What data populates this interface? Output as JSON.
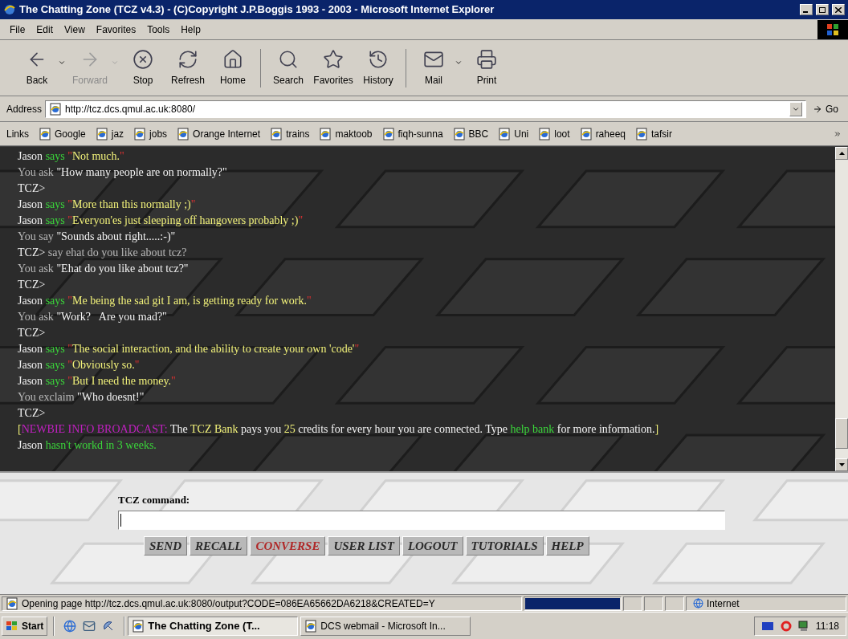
{
  "window": {
    "title": "The Chatting Zone (TCZ v4.3) - (C)Copyright J.P.Boggis 1993 - 2003 - Microsoft Internet Explorer"
  },
  "menu": [
    "File",
    "Edit",
    "View",
    "Favorites",
    "Tools",
    "Help"
  ],
  "toolbar": [
    [
      {
        "label": "Back",
        "kind": "back",
        "disabled": false,
        "dropdown": true
      },
      {
        "label": "Forward",
        "kind": "forward",
        "disabled": true,
        "dropdown": true
      },
      {
        "label": "Stop",
        "kind": "stop",
        "disabled": false,
        "dropdown": false
      },
      {
        "label": "Refresh",
        "kind": "refresh",
        "disabled": false,
        "dropdown": false
      },
      {
        "label": "Home",
        "kind": "home",
        "disabled": false,
        "dropdown": false
      }
    ],
    [
      {
        "label": "Search",
        "kind": "search",
        "disabled": false,
        "dropdown": false
      },
      {
        "label": "Favorites",
        "kind": "favorites",
        "disabled": false,
        "dropdown": false
      },
      {
        "label": "History",
        "kind": "history",
        "disabled": false,
        "dropdown": false
      }
    ],
    [
      {
        "label": "Mail",
        "kind": "mail",
        "disabled": false,
        "dropdown": true
      },
      {
        "label": "Print",
        "kind": "print",
        "disabled": false,
        "dropdown": false
      }
    ]
  ],
  "address": {
    "label": "Address",
    "value": "http://tcz.dcs.qmul.ac.uk:8080/",
    "go": "Go"
  },
  "links": {
    "label": "Links",
    "items": [
      "Google",
      "jaz",
      "jobs",
      "Orange Internet",
      "trains",
      "maktoob",
      "fiqh-sunna",
      "BBC",
      "Uni",
      "loot",
      "raheeq",
      "tafsir"
    ]
  },
  "chat": [
    [
      {
        "kind": "name",
        "text": "Jason"
      },
      {
        "kind": "verb",
        "text": " says "
      },
      {
        "kind": "mark",
        "text": "\""
      },
      {
        "kind": "speech",
        "text": "Not much."
      },
      {
        "kind": "mark",
        "text": "\""
      }
    ],
    [
      {
        "kind": "you",
        "text": "You ask "
      },
      {
        "kind": "plain",
        "text": "\"How many people are on normally?\""
      }
    ],
    [
      {
        "kind": "plain",
        "text": "TCZ>"
      }
    ],
    [
      {
        "kind": "name",
        "text": "Jason"
      },
      {
        "kind": "verb",
        "text": " says "
      },
      {
        "kind": "mark",
        "text": "\""
      },
      {
        "kind": "speech",
        "text": "More than this normally ;)"
      },
      {
        "kind": "mark",
        "text": "\""
      }
    ],
    [
      {
        "kind": "name",
        "text": "Jason"
      },
      {
        "kind": "verb",
        "text": " says "
      },
      {
        "kind": "mark",
        "text": "\""
      },
      {
        "kind": "speech",
        "text": "Everyon'es just sleeping off hangovers probably ;)"
      },
      {
        "kind": "mark",
        "text": "\""
      }
    ],
    [
      {
        "kind": "you",
        "text": "You say "
      },
      {
        "kind": "plain",
        "text": "\"Sounds about right.....:-)\""
      }
    ],
    [
      {
        "kind": "plain",
        "text": "TCZ>"
      },
      {
        "kind": "you",
        "text": " say ehat do you like about tcz?"
      }
    ],
    [
      {
        "kind": "you",
        "text": "You ask "
      },
      {
        "kind": "plain",
        "text": "\"Ehat do you like about tcz?\""
      }
    ],
    [
      {
        "kind": "plain",
        "text": "TCZ>"
      }
    ],
    [
      {
        "kind": "name",
        "text": "Jason"
      },
      {
        "kind": "verb",
        "text": " says "
      },
      {
        "kind": "mark",
        "text": "\""
      },
      {
        "kind": "speech",
        "text": "Me being the sad git I am, is getting ready for work."
      },
      {
        "kind": "mark",
        "text": "\""
      }
    ],
    [
      {
        "kind": "you",
        "text": "You ask "
      },
      {
        "kind": "plain",
        "text": "\"Work?   Are you mad?\""
      }
    ],
    [
      {
        "kind": "plain",
        "text": "TCZ>"
      }
    ],
    [
      {
        "kind": "name",
        "text": "Jason"
      },
      {
        "kind": "verb",
        "text": " says "
      },
      {
        "kind": "mark",
        "text": "\""
      },
      {
        "kind": "speech",
        "text": "The social interaction, and the ability to create your own 'code'"
      },
      {
        "kind": "mark",
        "text": "\""
      }
    ],
    [
      {
        "kind": "name",
        "text": "Jason"
      },
      {
        "kind": "verb",
        "text": " says "
      },
      {
        "kind": "mark",
        "text": "\""
      },
      {
        "kind": "speech",
        "text": "Obviously so."
      },
      {
        "kind": "mark",
        "text": "\""
      }
    ],
    [
      {
        "kind": "name",
        "text": "Jason"
      },
      {
        "kind": "verb",
        "text": " says "
      },
      {
        "kind": "mark",
        "text": "\""
      },
      {
        "kind": "speech",
        "text": "But I need the money."
      },
      {
        "kind": "mark",
        "text": "\""
      }
    ],
    [
      {
        "kind": "you",
        "text": "You exclaim "
      },
      {
        "kind": "plain",
        "text": "\"Who doesnt!\""
      }
    ],
    [
      {
        "kind": "plain",
        "text": "TCZ>"
      }
    ],
    [
      {
        "kind": "speech",
        "text": "["
      },
      {
        "kind": "broadcast",
        "text": "NEWBIE INFO BROADCAST:"
      },
      {
        "kind": "plain",
        "text": " The "
      },
      {
        "kind": "speech",
        "text": "TCZ Bank"
      },
      {
        "kind": "plain",
        "text": " pays you "
      },
      {
        "kind": "speech",
        "text": "25"
      },
      {
        "kind": "plain",
        "text": " credits for every hour you are connected. Type "
      },
      {
        "kind": "verb",
        "text": "help bank"
      },
      {
        "kind": "plain",
        "text": " for more information."
      },
      {
        "kind": "speech",
        "text": "]"
      }
    ],
    [
      {
        "kind": "name",
        "text": "Jason"
      },
      {
        "kind": "verb",
        "text": " hasn't workd in 3 weeks."
      }
    ]
  ],
  "command": {
    "label": "TCZ command:"
  },
  "buttons": [
    {
      "label": "SEND",
      "selected": false
    },
    {
      "label": "RECALL",
      "selected": false
    },
    {
      "label": "CONVERSE",
      "selected": true
    },
    {
      "label": "USER LIST",
      "selected": false
    },
    {
      "label": "LOGOUT",
      "selected": false
    },
    {
      "label": "TUTORIALS",
      "selected": false
    },
    {
      "label": "HELP",
      "selected": false
    }
  ],
  "status": {
    "text": "Opening page http://tcz.dcs.qmul.ac.uk:8080/output?CODE=086EA65662DA6218&CREATED=Y",
    "level": 1,
    "zone": "Internet"
  },
  "taskbar": {
    "start": "Start",
    "tasks": [
      {
        "label": "The Chatting Zone (T...",
        "selected": true
      },
      {
        "label": "DCS webmail - Microsoft In...",
        "selected": false
      }
    ],
    "clock": "11:18"
  }
}
